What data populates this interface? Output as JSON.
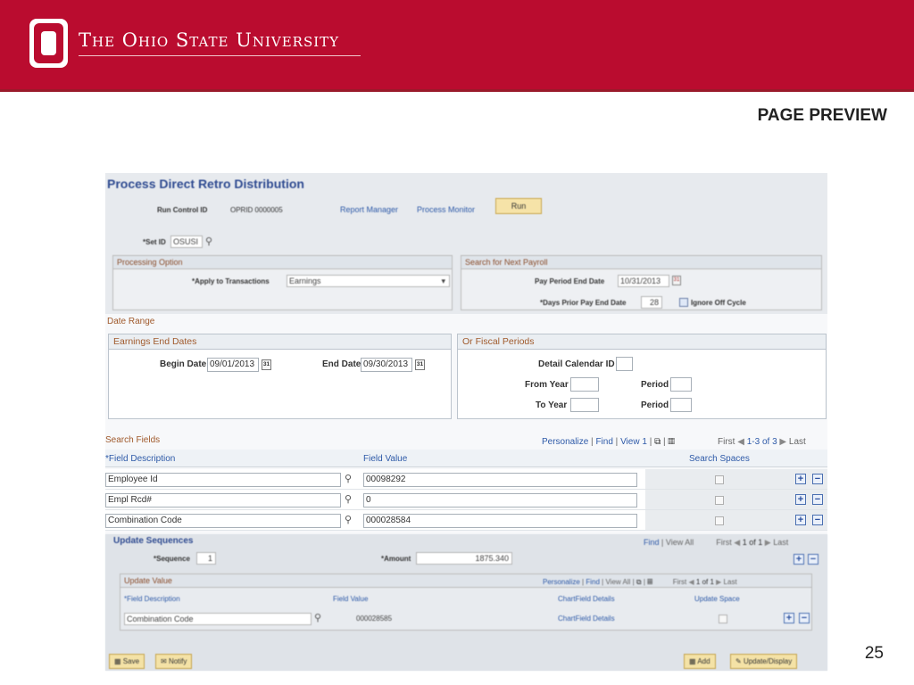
{
  "header": {
    "university_name": "The Ohio State University",
    "page_preview": "PAGE PREVIEW",
    "page_number": "25"
  },
  "top": {
    "title": "Process Direct Retro Distribution",
    "run_control_label": "Run Control ID",
    "run_control_value": "OPRID 0000005",
    "report_manager": "Report Manager",
    "process_monitor": "Process Monitor",
    "run_button": "Run",
    "set_id_label": "*Set ID",
    "set_id_value": "OSUSI",
    "processing_option": {
      "title": "Processing Option",
      "apply_label": "*Apply to Transactions",
      "apply_value": "Earnings"
    },
    "search_next_payroll": {
      "title": "Search for Next Payroll",
      "pay_period_label": "Pay Period End Date",
      "pay_period_value": "10/31/2013",
      "days_prior_label": "*Days Prior Pay End Date",
      "days_prior_value": "28",
      "ignore_off_cycle": "Ignore Off Cycle"
    }
  },
  "date_range": {
    "title": "Date Range",
    "earnings_end_dates": {
      "title": "Earnings End Dates",
      "begin_label": "Begin Date",
      "begin_value": "09/01/2013",
      "end_label": "End Date",
      "end_value": "09/30/2013"
    },
    "fiscal_periods": {
      "title": "Or Fiscal Periods",
      "detail_calendar_label": "Detail Calendar ID",
      "from_year_label": "From Year",
      "to_year_label": "To Year",
      "period_label": "Period"
    }
  },
  "search_fields": {
    "title": "Search Fields",
    "nav": {
      "personalize": "Personalize",
      "find": "Find",
      "view": "View 1",
      "first": "First",
      "range": "1-3 of 3",
      "last": "Last"
    },
    "columns": [
      "*Field Description",
      "Field Value",
      "Search Spaces"
    ],
    "rows": [
      {
        "description": "Employee Id",
        "value": "00098292"
      },
      {
        "description": "Empl Rcd#",
        "value": "0"
      },
      {
        "description": "Combination Code",
        "value": "000028584"
      }
    ]
  },
  "update_sequences": {
    "title": "Update Sequences",
    "find": "Find",
    "view_all": "View All",
    "first": "First",
    "range": "1 of 1",
    "last": "Last",
    "sequence_label": "*Sequence",
    "sequence_value": "1",
    "amount_label": "*Amount",
    "amount_value": "1875.340",
    "update_value": {
      "title": "Update Value",
      "nav_personalize": "Personalize",
      "nav_find": "Find",
      "nav_view_all": "View All",
      "nav_first": "First",
      "nav_range": "1 of 1",
      "nav_last": "Last",
      "columns": [
        "*Field Description",
        "Field Value",
        "ChartField Details",
        "Update Space"
      ],
      "row_description": "Combination Code",
      "row_value": "000028585",
      "row_details": "ChartField Details"
    }
  },
  "footer": {
    "save": "Save",
    "notify": "Notify",
    "add": "Add",
    "update_display": "Update/Display"
  },
  "icons": {
    "lookup": "magnifier-icon",
    "calendar": "calendar-icon",
    "add_row": "plus-icon",
    "delete_row": "minus-icon"
  },
  "colors": {
    "brand_red": "#ba0c2f",
    "link_blue": "#2e5aa8",
    "section_brown": "#a05a2c"
  }
}
